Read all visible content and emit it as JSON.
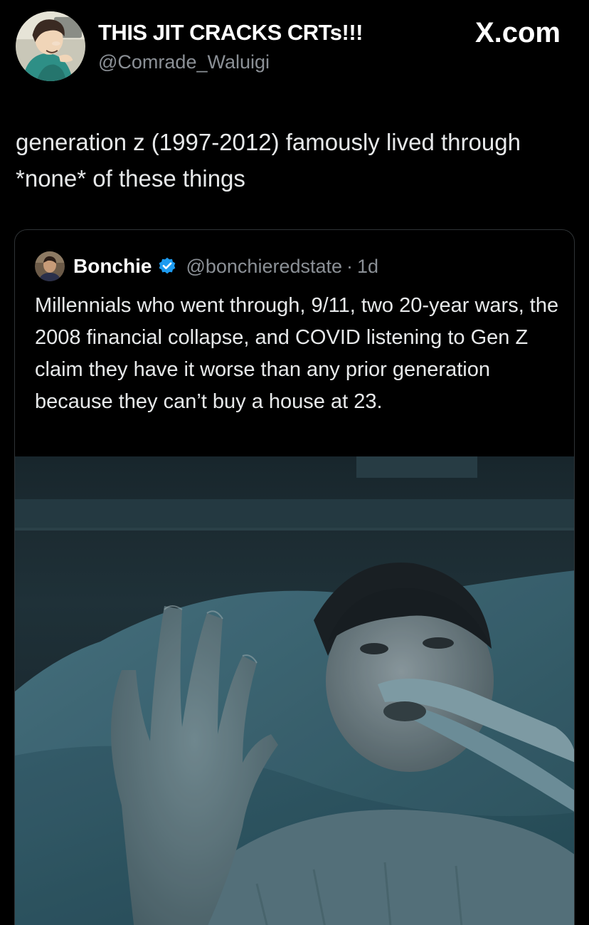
{
  "post": {
    "display_name": "THIS JIT CRACKS CRTs!!!",
    "handle": "@Comrade_Waluigi",
    "avatar_icon": "cartoon-avatar-icon",
    "brand": "X.com",
    "text": "generation z (1997-2012) famously lived through *none* of these things"
  },
  "quoted": {
    "display_name": "Bonchie",
    "verified_icon": "verified-badge-icon",
    "verified_color": "#1d9bf0",
    "handle": "@bonchieredstate",
    "separator": "·",
    "time": "1d",
    "text": "Millennials who went through, 9/11, two 20-year wars, the 2008 financial collapse, and COVID listening to Gen Z claim they have it worse than any prior generation because they can’t buy a house at 23.",
    "media_icon": "video-still-hospital-patient-waving"
  },
  "colors": {
    "background": "#000000",
    "primary_text": "#e7e9ea",
    "secondary_text": "#8b9096",
    "card_border": "#2f3336"
  }
}
